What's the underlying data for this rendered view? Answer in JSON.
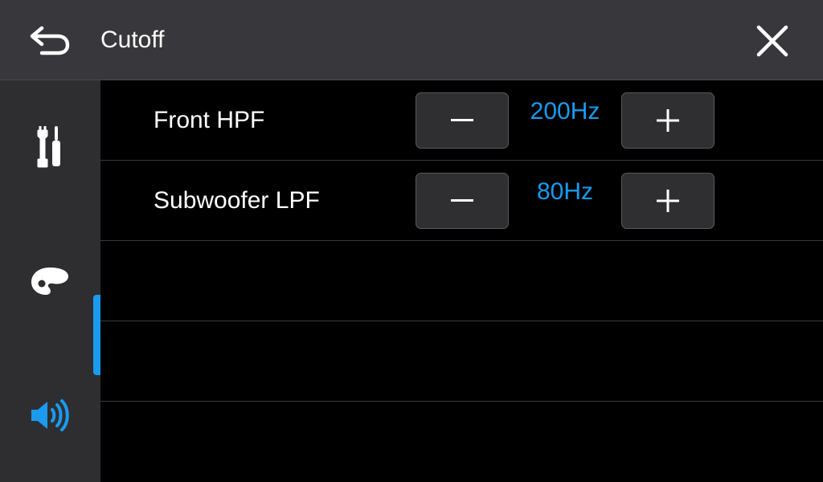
{
  "header": {
    "title": "Cutoff",
    "back_icon": "back-arrow-icon",
    "close_icon": "close-icon"
  },
  "sidebar": {
    "items": [
      {
        "icon": "tools-icon",
        "name": "settings-tools",
        "active": false
      },
      {
        "icon": "palette-icon",
        "name": "theme",
        "active": false
      },
      {
        "icon": "speaker-icon",
        "name": "sound",
        "active": true
      }
    ],
    "active_color": "#1a9bf0"
  },
  "rows": [
    {
      "label": "Front HPF",
      "value": "200Hz"
    },
    {
      "label": "Subwoofer LPF",
      "value": "80Hz"
    }
  ],
  "colors": {
    "accent": "#1a9bf0",
    "header_bg": "#38383c",
    "sidebar_bg": "#2e2e31",
    "content_bg": "#000000"
  }
}
